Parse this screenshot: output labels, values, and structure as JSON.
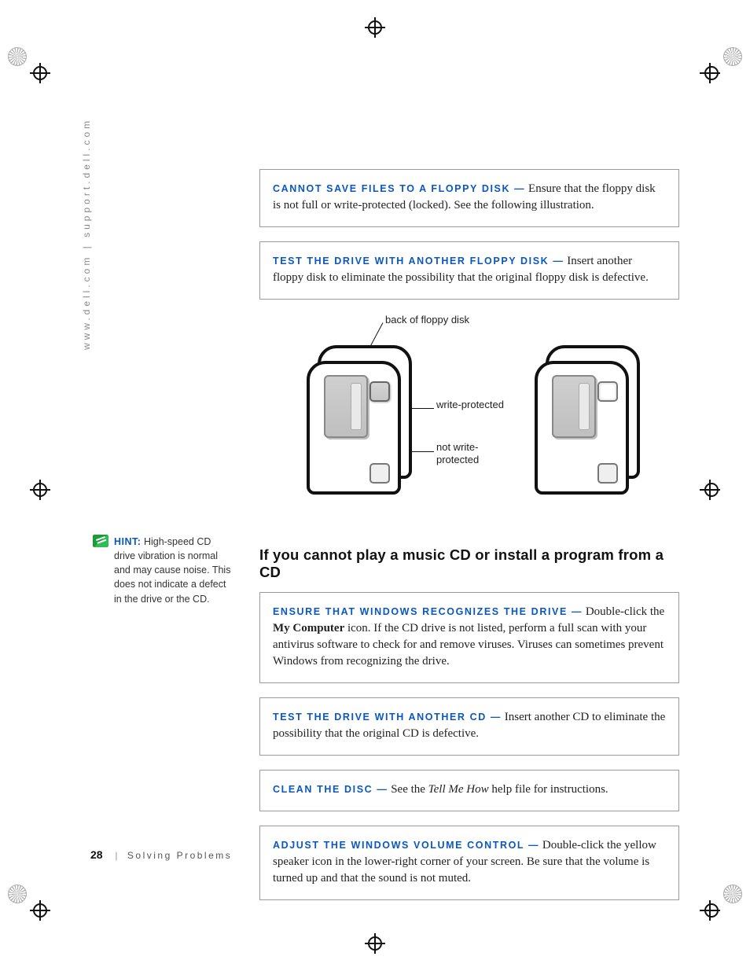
{
  "side_url": "www.dell.com | support.dell.com",
  "boxes_top": [
    {
      "lead": "CANNOT SAVE FILES TO A FLOPPY DISK —",
      "body": "Ensure that the floppy disk is not full or write-protected (locked). See the following illustration."
    },
    {
      "lead": "TEST THE DRIVE WITH ANOTHER FLOPPY DISK —",
      "body": "Insert another floppy disk to eliminate the possibility that the original floppy disk is defective."
    }
  ],
  "illus": {
    "back_label": "back of floppy disk",
    "wp_label": "write-protected",
    "nwp_label_line1": "not write-",
    "nwp_label_line2": "protected"
  },
  "heading": "If you cannot play a music CD or install a program from a CD",
  "hint": {
    "label": "HINT:",
    "text": "High-speed CD drive vibration is normal and may cause noise. This does not indicate a defect in the drive or the CD."
  },
  "boxes_bottom": [
    {
      "lead": "ENSURE THAT WINDOWS RECOGNIZES THE DRIVE —",
      "body_prefix": "Double-click the ",
      "bold": "My Computer",
      "body_suffix": " icon. If the CD drive is not listed, perform a full scan with your antivirus software to check for and remove viruses. Viruses can sometimes prevent Windows from recognizing the drive."
    },
    {
      "lead": "TEST THE DRIVE WITH ANOTHER CD —",
      "body": "Insert another CD to eliminate the possibility that the original CD is defective."
    },
    {
      "lead": "CLEAN THE DISC —",
      "body_prefix": "See the ",
      "italic": "Tell Me How",
      "body_suffix": " help file for instructions."
    },
    {
      "lead": "ADJUST THE WINDOWS VOLUME CONTROL —",
      "body": "Double-click the yellow speaker icon in the lower-right corner of your screen. Be sure that the volume is turned up and that the sound is not muted."
    }
  ],
  "footer": {
    "page": "28",
    "section": "Solving Problems"
  }
}
